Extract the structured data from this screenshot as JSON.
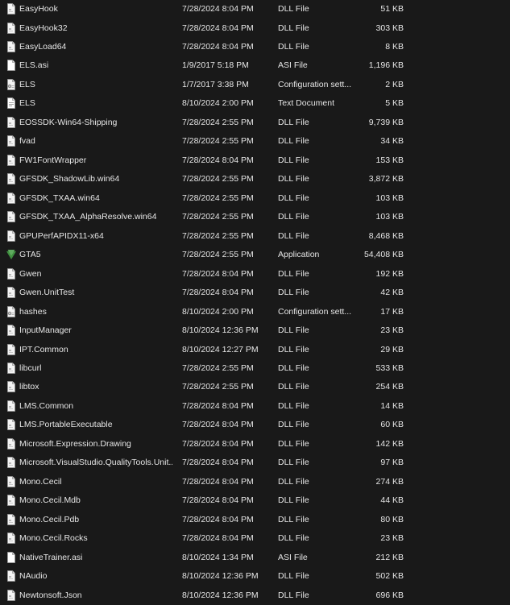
{
  "files": [
    {
      "name": "EasyHook",
      "date": "7/28/2024 8:04 PM",
      "type": "DLL File",
      "size": "51 KB",
      "icon": "dll-file-icon"
    },
    {
      "name": "EasyHook32",
      "date": "7/28/2024 8:04 PM",
      "type": "DLL File",
      "size": "303 KB",
      "icon": "dll-file-icon"
    },
    {
      "name": "EasyLoad64",
      "date": "7/28/2024 8:04 PM",
      "type": "DLL File",
      "size": "8 KB",
      "icon": "dll-file-icon"
    },
    {
      "name": "ELS.asi",
      "date": "1/9/2017 5:18 PM",
      "type": "ASI File",
      "size": "1,196 KB",
      "icon": "blank-file-icon"
    },
    {
      "name": "ELS",
      "date": "1/7/2017 3:38 PM",
      "type": "Configuration sett...",
      "size": "2 KB",
      "icon": "config-file-icon"
    },
    {
      "name": "ELS",
      "date": "8/10/2024 2:00 PM",
      "type": "Text Document",
      "size": "5 KB",
      "icon": "text-file-icon"
    },
    {
      "name": "EOSSDK-Win64-Shipping",
      "date": "7/28/2024 2:55 PM",
      "type": "DLL File",
      "size": "9,739 KB",
      "icon": "dll-file-icon"
    },
    {
      "name": "fvad",
      "date": "7/28/2024 2:55 PM",
      "type": "DLL File",
      "size": "34 KB",
      "icon": "dll-file-icon"
    },
    {
      "name": "FW1FontWrapper",
      "date": "7/28/2024 8:04 PM",
      "type": "DLL File",
      "size": "153 KB",
      "icon": "dll-file-icon"
    },
    {
      "name": "GFSDK_ShadowLib.win64",
      "date": "7/28/2024 2:55 PM",
      "type": "DLL File",
      "size": "3,872 KB",
      "icon": "dll-file-icon"
    },
    {
      "name": "GFSDK_TXAA.win64",
      "date": "7/28/2024 2:55 PM",
      "type": "DLL File",
      "size": "103 KB",
      "icon": "dll-file-icon"
    },
    {
      "name": "GFSDK_TXAA_AlphaResolve.win64",
      "date": "7/28/2024 2:55 PM",
      "type": "DLL File",
      "size": "103 KB",
      "icon": "dll-file-icon"
    },
    {
      "name": "GPUPerfAPIDX11-x64",
      "date": "7/28/2024 2:55 PM",
      "type": "DLL File",
      "size": "8,468 KB",
      "icon": "dll-file-icon"
    },
    {
      "name": "GTA5",
      "date": "7/28/2024 2:55 PM",
      "type": "Application",
      "size": "54,408 KB",
      "icon": "gta5-app-icon"
    },
    {
      "name": "Gwen",
      "date": "7/28/2024 8:04 PM",
      "type": "DLL File",
      "size": "192 KB",
      "icon": "dll-file-icon"
    },
    {
      "name": "Gwen.UnitTest",
      "date": "7/28/2024 8:04 PM",
      "type": "DLL File",
      "size": "42 KB",
      "icon": "dll-file-icon"
    },
    {
      "name": "hashes",
      "date": "8/10/2024 2:00 PM",
      "type": "Configuration sett...",
      "size": "17 KB",
      "icon": "config-file-icon"
    },
    {
      "name": "InputManager",
      "date": "8/10/2024 12:36 PM",
      "type": "DLL File",
      "size": "23 KB",
      "icon": "dll-file-icon"
    },
    {
      "name": "IPT.Common",
      "date": "8/10/2024 12:27 PM",
      "type": "DLL File",
      "size": "29 KB",
      "icon": "dll-file-icon"
    },
    {
      "name": "libcurl",
      "date": "7/28/2024 2:55 PM",
      "type": "DLL File",
      "size": "533 KB",
      "icon": "dll-file-icon"
    },
    {
      "name": "libtox",
      "date": "7/28/2024 2:55 PM",
      "type": "DLL File",
      "size": "254 KB",
      "icon": "dll-file-icon"
    },
    {
      "name": "LMS.Common",
      "date": "7/28/2024 8:04 PM",
      "type": "DLL File",
      "size": "14 KB",
      "icon": "dll-file-icon"
    },
    {
      "name": "LMS.PortableExecutable",
      "date": "7/28/2024 8:04 PM",
      "type": "DLL File",
      "size": "60 KB",
      "icon": "dll-file-icon"
    },
    {
      "name": "Microsoft.Expression.Drawing",
      "date": "7/28/2024 8:04 PM",
      "type": "DLL File",
      "size": "142 KB",
      "icon": "dll-file-icon"
    },
    {
      "name": "Microsoft.VisualStudio.QualityTools.Unit...",
      "date": "7/28/2024 8:04 PM",
      "type": "DLL File",
      "size": "97 KB",
      "icon": "dll-file-icon"
    },
    {
      "name": "Mono.Cecil",
      "date": "7/28/2024 8:04 PM",
      "type": "DLL File",
      "size": "274 KB",
      "icon": "dll-file-icon"
    },
    {
      "name": "Mono.Cecil.Mdb",
      "date": "7/28/2024 8:04 PM",
      "type": "DLL File",
      "size": "44 KB",
      "icon": "dll-file-icon"
    },
    {
      "name": "Mono.Cecil.Pdb",
      "date": "7/28/2024 8:04 PM",
      "type": "DLL File",
      "size": "80 KB",
      "icon": "dll-file-icon"
    },
    {
      "name": "Mono.Cecil.Rocks",
      "date": "7/28/2024 8:04 PM",
      "type": "DLL File",
      "size": "23 KB",
      "icon": "dll-file-icon"
    },
    {
      "name": "NativeTrainer.asi",
      "date": "8/10/2024 1:34 PM",
      "type": "ASI File",
      "size": "212 KB",
      "icon": "blank-file-icon"
    },
    {
      "name": "NAudio",
      "date": "8/10/2024 12:36 PM",
      "type": "DLL File",
      "size": "502 KB",
      "icon": "dll-file-icon"
    },
    {
      "name": "Newtonsoft.Json",
      "date": "8/10/2024 12:36 PM",
      "type": "DLL File",
      "size": "696 KB",
      "icon": "dll-file-icon"
    }
  ]
}
